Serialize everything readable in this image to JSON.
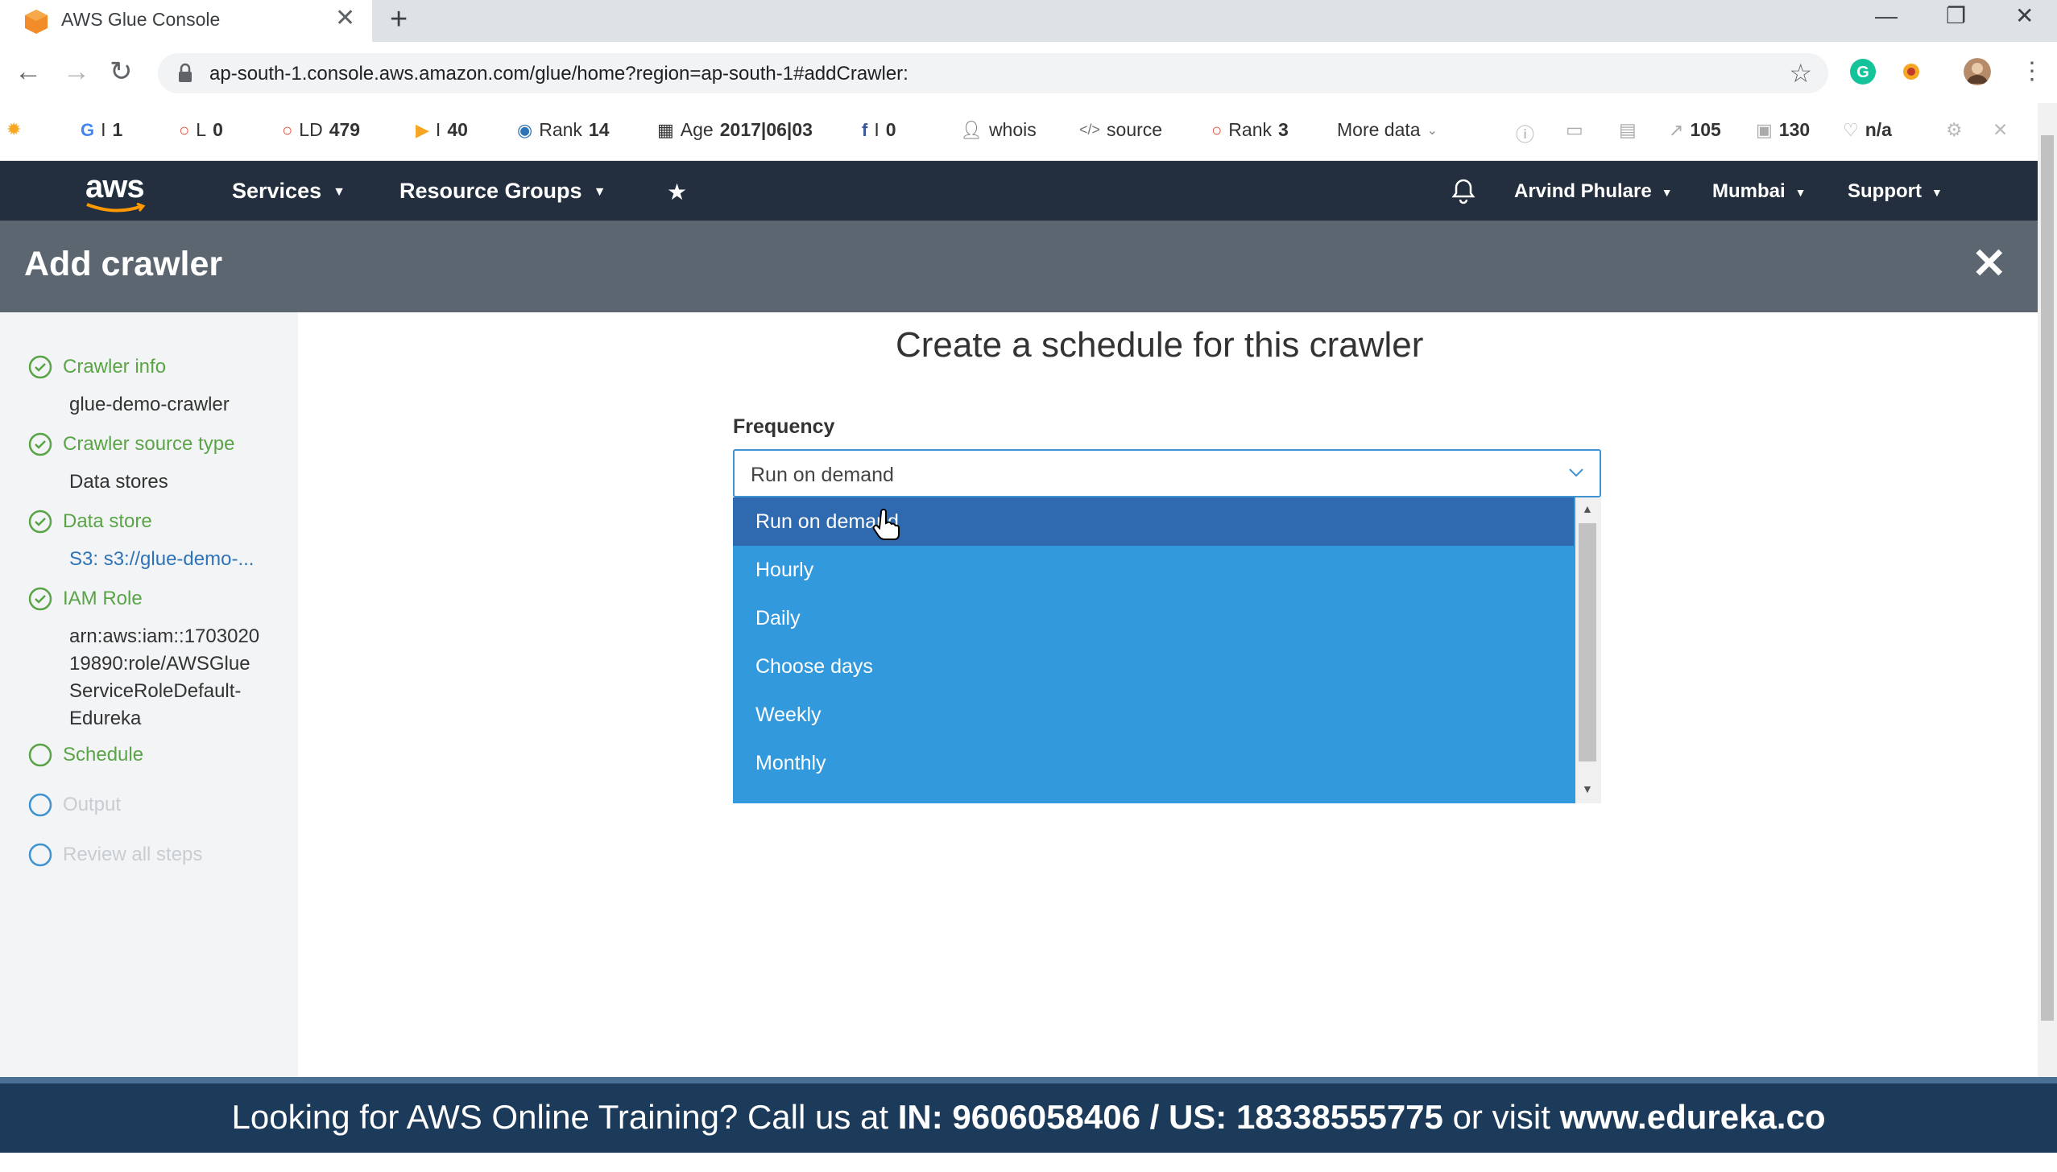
{
  "browser": {
    "tab_title": "AWS Glue Console",
    "url": "ap-south-1.console.aws.amazon.com/glue/home?region=ap-south-1#addCrawler:",
    "toolbar": {
      "g_label": "I",
      "g_value": "1",
      "l_label": "L",
      "l_value": "0",
      "ld": "LD",
      "ld_value": "479",
      "i_label": "I",
      "i_value": "40",
      "rank1_label": "Rank",
      "rank1_value": "14",
      "age_label": "Age",
      "age_value": "2017|06|03",
      "fb_label": "I",
      "fb_value": "0",
      "whois": "whois",
      "source": "source",
      "rank2_label": "Rank",
      "rank2_value": "3",
      "more_data": "More data",
      "links_value": "105",
      "pages_value": "130",
      "na_value": "n/a"
    }
  },
  "aws_nav": {
    "logo": "aws",
    "services": "Services",
    "resource_groups": "Resource Groups",
    "user": "Arvind Phulare",
    "region": "Mumbai",
    "support": "Support"
  },
  "header": {
    "title": "Add crawler"
  },
  "steps": [
    {
      "label": "Crawler info",
      "detail": "glue-demo-crawler"
    },
    {
      "label": "Crawler source type",
      "detail": "Data stores"
    },
    {
      "label": "Data store",
      "detail": "S3: s3://glue-demo-..."
    },
    {
      "label": "IAM Role",
      "detail_lines": [
        "arn:aws:iam::1703020",
        "19890:role/AWSGlue",
        "ServiceRoleDefault-",
        "Edureka"
      ]
    },
    {
      "label": "Schedule"
    },
    {
      "label": "Output"
    },
    {
      "label": "Review all steps"
    }
  ],
  "main": {
    "title": "Create a schedule for this crawler",
    "frequency_label": "Frequency",
    "frequency_value": "Run on demand",
    "options": [
      "Run on demand",
      "Hourly",
      "Daily",
      "Choose days",
      "Weekly",
      "Monthly"
    ],
    "selected_option": "Run on demand"
  },
  "banner": {
    "prefix": "Looking for AWS Online Training? Call us at ",
    "phones": "IN: 9606058406 / US: 18338555775",
    "middle": " or visit ",
    "site": "www.edureka.co"
  },
  "colors": {
    "aws_nav_bg": "#232f3e",
    "header_bg": "#5b6670",
    "step_complete": "#5aa447",
    "dropdown_bg": "#3399dd",
    "dropdown_selected": "#2f6ab0",
    "banner_bg": "#1c3a5a"
  }
}
